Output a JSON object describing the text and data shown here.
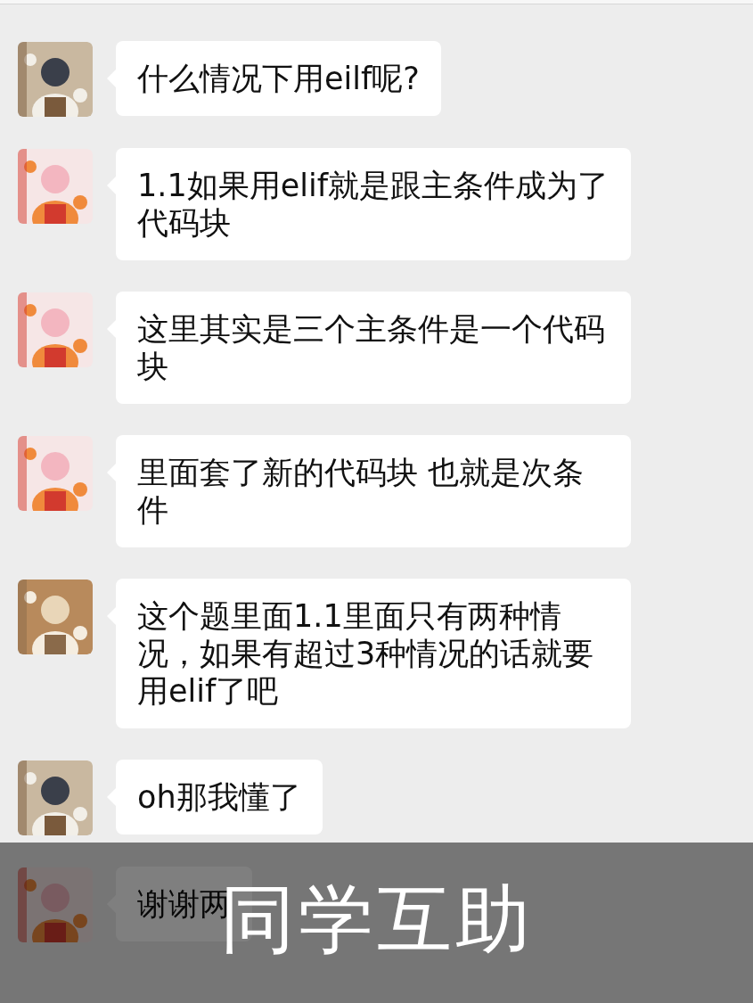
{
  "messages": [
    {
      "text": "什么情况下用eilf呢?"
    },
    {
      "text": "1.1如果用elif就是跟主条件成为了代码块"
    },
    {
      "text": "这里其实是三个主条件是一个代码块"
    },
    {
      "text": "里面套了新的代码块 也就是次条件"
    },
    {
      "text": "这个题里面1.1里面只有两种情况，如果有超过3种情况的话就要用elif了吧"
    },
    {
      "text": "oh那我懂了"
    },
    {
      "text": "谢谢两"
    }
  ],
  "overlay": {
    "caption": "同学互助"
  }
}
